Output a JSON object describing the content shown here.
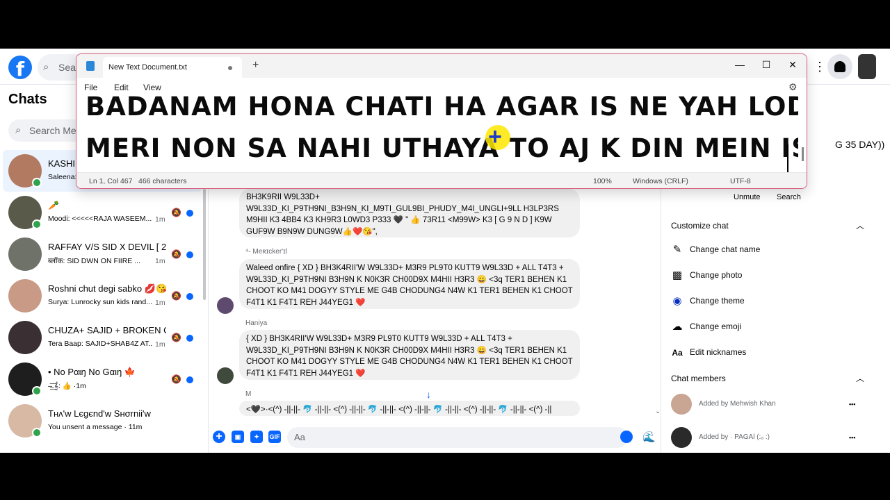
{
  "facebook": {
    "logo_letter": "f",
    "search_placeholder": "Searc"
  },
  "chats": {
    "title": "Chats",
    "search_placeholder": "Search Mess",
    "items": [
      {
        "name": "KASHII",
        "preview": "Saleena:",
        "time": "",
        "online": true,
        "unread": false,
        "active": true,
        "avatar_color": "#b27a60"
      },
      {
        "name": "🥕",
        "preview": "Moodi: <<<<<RAJA WASEEM...",
        "time": "1m",
        "online": true,
        "unread": true,
        "active": false,
        "avatar_color": "#5a5a4a"
      },
      {
        "name": "RAFFAY V/S SID X DEVIL [ 20...",
        "preview": "ब्लॉक: SID DWN ON FIIRE ...",
        "time": "1m",
        "online": false,
        "unread": true,
        "active": false,
        "avatar_color": "#6e7268"
      },
      {
        "name": "Roshni chut degi sabko 💋😘",
        "preview": "Surya: Lunrocky sun kids rand...",
        "time": "1m",
        "online": false,
        "unread": true,
        "active": false,
        "avatar_color": "#c99a86"
      },
      {
        "name": "CHUZA+ SAJID + BROKEN C...",
        "preview": "Tera Baap: SAJID+SHAB4Z AT...",
        "time": "1m",
        "online": false,
        "unread": true,
        "active": false,
        "avatar_color": "#3a2f33"
      },
      {
        "name": "• No Pαιŋ No Gαιŋ 🍁",
        "preview": "–̶͟͞ 𝄞: 👍 ·1m",
        "time": "",
        "online": true,
        "unread": true,
        "active": false,
        "avatar_color": "#1e1e1e"
      },
      {
        "name": "Tнᴧ'w Lєgєnd'w Sнσrnii'w",
        "preview": "You unsent a message · 11m",
        "time": "",
        "online": true,
        "unread": false,
        "active": false,
        "avatar_color": "#d8b9a4"
      }
    ]
  },
  "conversation": {
    "messages": [
      {
        "sender": "",
        "avatar_color": "#a05060",
        "text": "BH3K9RII W9L33D+ W9L33D_KI_P9TH9NI_B3H9N_KI_M9TI_GUL9BI_PHUDY_M4I_UNGLI+9LL H3LP3RS M9HII K3 4BB4 K3 KH9R3 L0WD3 P333 🖤 \" 👍 73R11 <M99W> K3 [ G 9 N D ] K9W GUF9W B9N9W DUNG9W👍❤️😘\","
      },
      {
        "sender": "⁴- Meʀɪcker'ɪl",
        "avatar_color": "#5d4a6e",
        "text": "Waleed onfire { XD } BH3K4RII'W W9L33D+ M3R9 PL9T0 KUTT9 W9L33D + ALL T4T3 + W9L33D_KI_P9TH9NI B3H9N K N0K3R CH00D9X M4HII H3R3 😀 <3q TER1 BEHEN K1 CHOOT KO M41 DOGYY STYLE ME G4B CHODUNG4 N4W K1 TER1 BEHEN K1 CHOOT F4T1 K1 F4T1 REH J44YEG1 ❤️"
      },
      {
        "sender": "Haniya",
        "avatar_color": "#3f4a3c",
        "text": "{ XD } BH3K4RII'W W9L33D+ M3R9 PL9T0 KUTT9 W9L33D + ALL T4T3 + W9L33D_KI_P9TH9NI B3H9N K N0K3R CH00D9X M4HII H3R3 😀 <3q TER1 BEHEN K1 CHOOT KO M41 DOGYY STYLE ME G4B CHODUNG4 N4W K1 TER1 BEHEN K1 CHOOT F4T1 K1 F4T1 REH J44YEG1 ❤️"
      },
      {
        "sender": "M",
        "avatar_color": "",
        "text": "<🖤>·<(^) -||-||- 🐬 -||-||- <(^) -||-||- 🐬 -||-||- <(^) -||-||- 🐬 -||-||- <(^) -||-||- 🐬 -||-||- <(^) -||"
      }
    ],
    "composer_placeholder": "Aa"
  },
  "details": {
    "partial_text": "G 35 DAY))",
    "unmute_label": "Unmute",
    "search_label": "Search",
    "customize_title": "Customize chat",
    "options": [
      {
        "icon": "pencil-icon",
        "label": "Change chat name"
      },
      {
        "icon": "photo-icon",
        "label": "Change photo"
      },
      {
        "icon": "theme-icon",
        "label": "Change theme"
      },
      {
        "icon": "emoji-icon",
        "label": "Change emoji"
      },
      {
        "icon": "nickname-icon",
        "label": "Edit nicknames"
      }
    ],
    "members_title": "Chat members",
    "members": [
      {
        "text": "Added by Mehwish Khan",
        "avatar_color": "#c9a593"
      },
      {
        "text": "Added by       · PAGAl (:ₒ :)",
        "avatar_color": "#2a2a2a"
      }
    ]
  },
  "notepad": {
    "tab_title": "New Text Document.txt",
    "menu": [
      "File",
      "Edit",
      "View"
    ],
    "lines": [
      "BADANAM HONA CHATI HA AGAR IS NE YAH LODER",
      "MERI NON SA NAHI UTHAYA TO AJ K DIN MEIN IS K"
    ],
    "status": {
      "position": "Ln 1, Col 467",
      "characters": "466 characters",
      "zoom": "100%",
      "line_ending": "Windows (CRLF)",
      "encoding": "UTF-8"
    }
  },
  "colors": {
    "facebook_blue": "#1877f2",
    "messenger_blue": "#0866ff",
    "online_green": "#31a24c",
    "notepad_border": "#d65c7a"
  }
}
